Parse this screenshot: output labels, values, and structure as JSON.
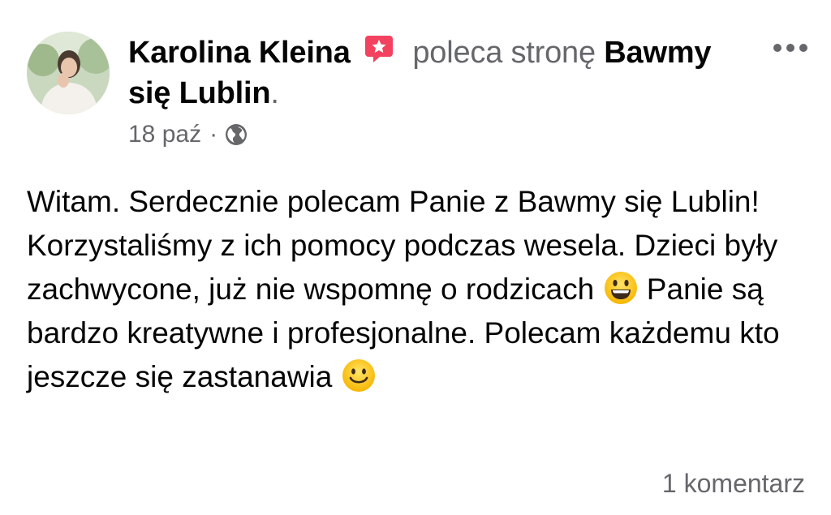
{
  "post": {
    "author": "Karolina Kleina",
    "action": "poleca stronę",
    "page_name_line1": "Bawmy",
    "page_name_line2": "się Lublin",
    "period": ".",
    "date": "18 paź",
    "separator": "·",
    "body": {
      "part1": "Witam. Serdecznie polecam Panie z Bawmy się Lublin! Korzystaliśmy z ich pomocy podczas wesela. Dzieci były zachwycone, już nie wspomnę o rodzicach ",
      "part2": " Panie są bardzo kreatywne i profesjonalne. Polecam każdemu kto jeszcze się zastanawia "
    },
    "comments": "1 komentarz"
  },
  "icons": {
    "recommendation": "recommendation-icon",
    "more": "more-options-icon",
    "privacy": "globe-icon",
    "emoji1": "grinning-face-emoji",
    "emoji2": "smiling-face-emoji"
  },
  "colors": {
    "primary_text": "#050505",
    "secondary_text": "#65676b",
    "recommend_icon": "#f3425f"
  }
}
